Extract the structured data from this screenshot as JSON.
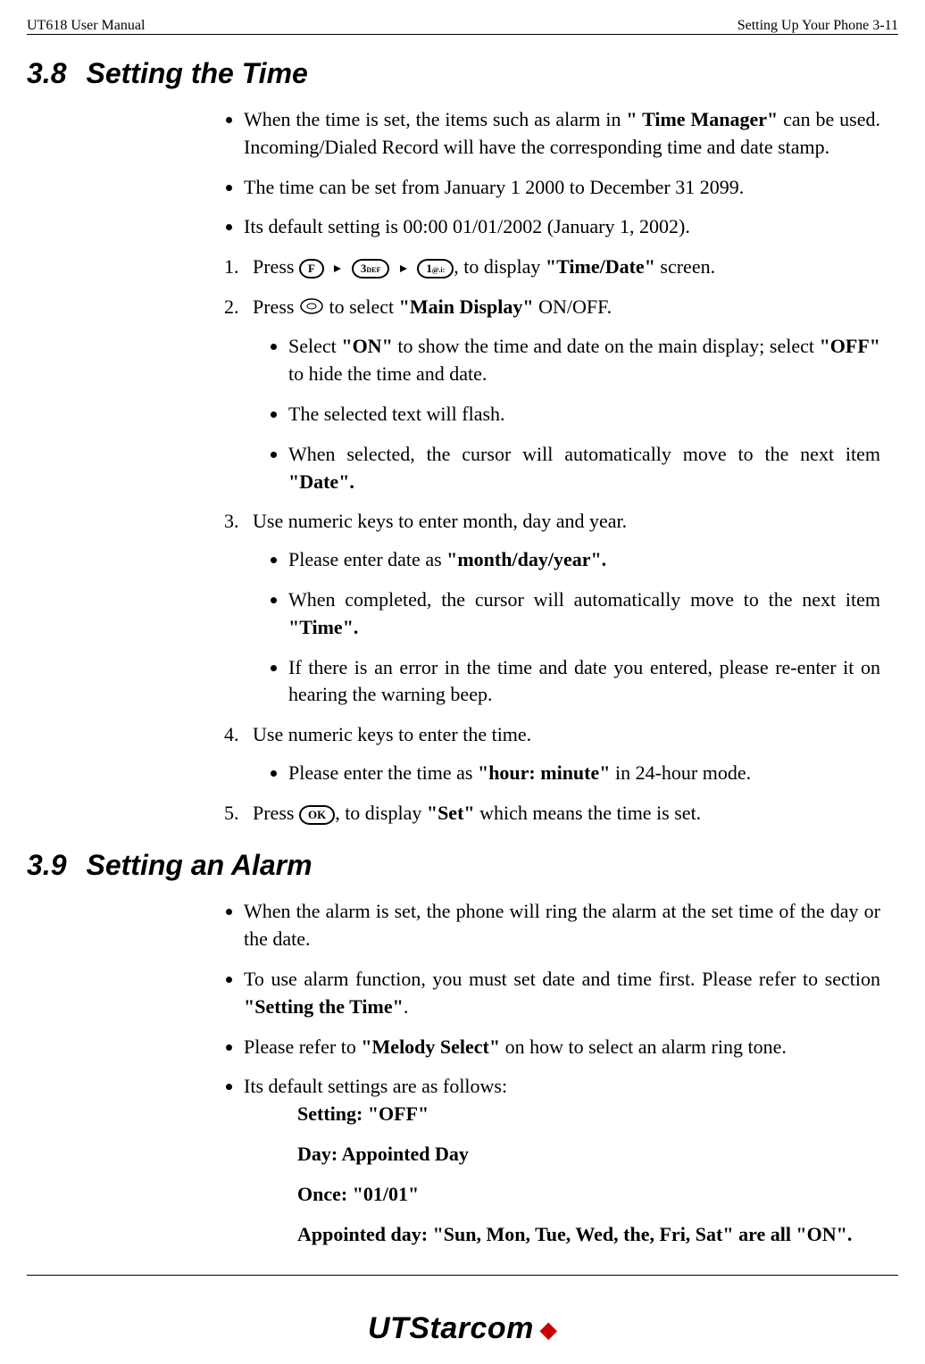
{
  "header": {
    "left": "UT618 User Manual",
    "right": "Setting Up Your Phone   3-11"
  },
  "section38": {
    "num": "3.8",
    "title": "Setting the Time",
    "b1a": "When the time is set, the items such as alarm in ",
    "b1b": "\" Time Manager\"",
    "b1c": " can be used. Incoming/Dialed Record will have the corresponding time and date stamp.",
    "b2": "The time can be set from January 1 2000 to December 31 2099.",
    "b3": "Its default setting is 00:00 01/01/2002 (January 1, 2002).",
    "s1a": "Press ",
    "s1b": ", to display ",
    "s1c": "\"Time/Date\"",
    "s1d": " screen.",
    "btnF": "F",
    "btn3": "3DEF",
    "btn1": "1@.i:",
    "btnOK": "OK",
    "s2a": "Press ",
    "s2b": " to select ",
    "s2c": "\"Main Display\"",
    "s2d": " ON/OFF.",
    "s2s1a": "Select ",
    "s2s1b": "\"ON\"",
    "s2s1c": " to show the time and date on the main display; select ",
    "s2s1d": "\"OFF\"",
    "s2s1e": " to hide the time and date.",
    "s2s2": "The selected text will flash.",
    "s2s3a": "When selected, the cursor will automatically move to the next item ",
    "s2s3b": "\"Date\".",
    "s3": "Use numeric keys to enter month, day and year.",
    "s3s1a": "Please enter date as ",
    "s3s1b": "\"month/day/year\".",
    "s3s2a": "When completed, the cursor will automatically move to the next item ",
    "s3s2b": "\"Time\".",
    "s3s3": "If there is an error in the time and date you entered, please re-enter it on hearing the warning beep.",
    "s4": "Use numeric keys to enter the time.",
    "s4s1a": "Please enter the time as ",
    "s4s1b": "\"hour: minute\"",
    "s4s1c": " in 24-hour mode.",
    "s5a": "Press ",
    "s5b": ", to display ",
    "s5c": "\"Set\"",
    "s5d": " which means the time is set."
  },
  "section39": {
    "num": "3.9",
    "title": "Setting an Alarm",
    "b1": "When the alarm is set, the phone will ring the alarm at the set time of the day or the date.",
    "b2a": "To use alarm function, you must set date and time first. Please refer to section ",
    "b2b": "\"Setting the Time\"",
    "b2c": ".",
    "b3a": "Please refer to ",
    "b3b": "\"Melody Select\"",
    "b3c": " on how to select an alarm ring tone.",
    "b4": "Its default settings are as follows:",
    "d1": "Setting: \"OFF\"",
    "d2": "Day: Appointed Day",
    "d3": "Once: \"01/01\"",
    "d4": "Appointed day: \"Sun, Mon, Tue, Wed, the, Fri, Sat\" are all \"ON\"."
  },
  "footer": {
    "logo_ut": "UT",
    "logo_starcom": "Starcom"
  }
}
